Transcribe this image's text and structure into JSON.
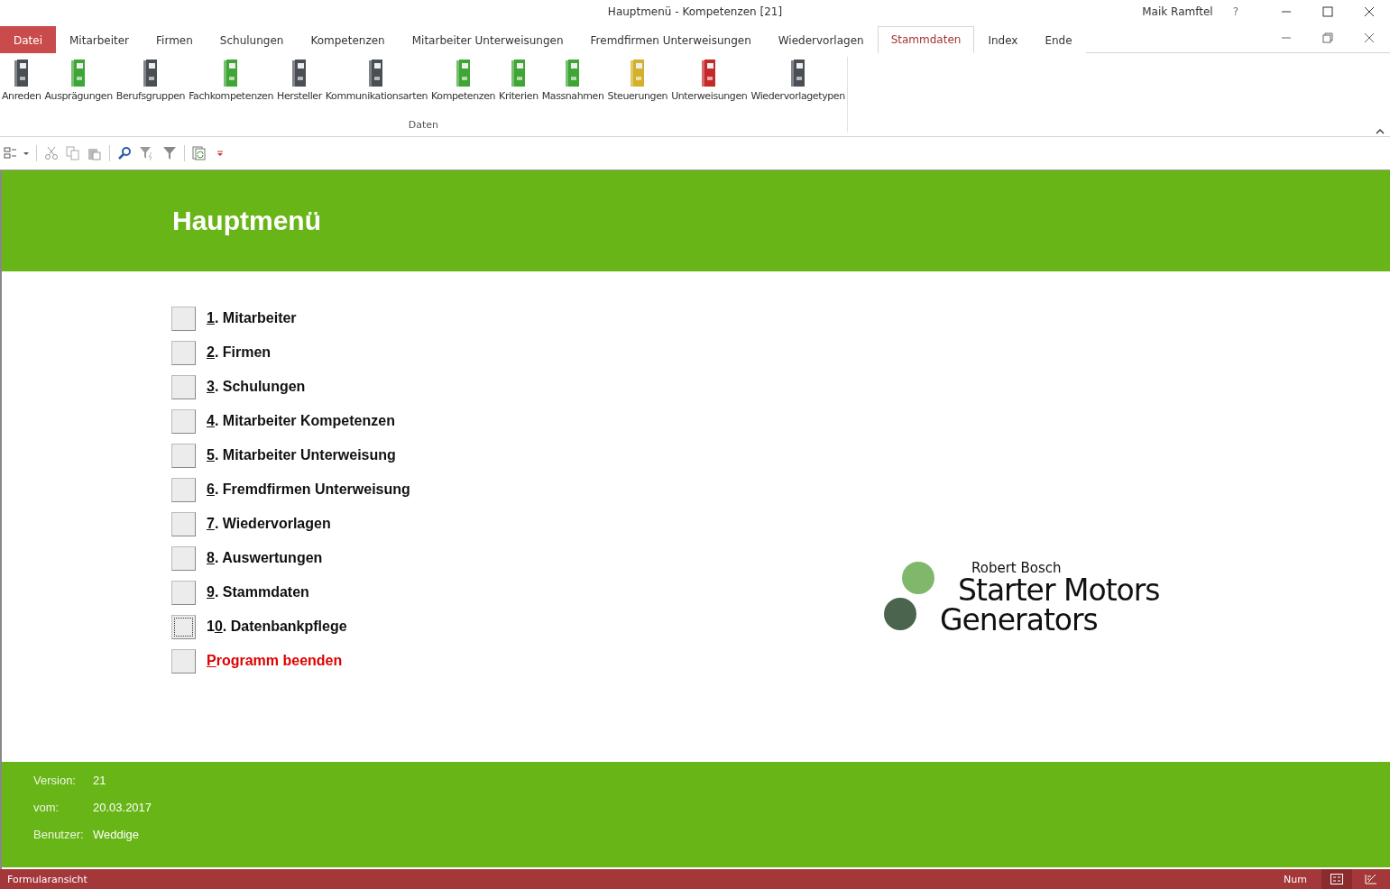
{
  "window": {
    "title": "Hauptmenü  -  Kompetenzen [21]",
    "user": "Maik Ramftel",
    "help": "?"
  },
  "tabs": [
    {
      "label": "Datei",
      "kind": "file",
      "selected": false
    },
    {
      "label": "Mitarbeiter",
      "kind": "tab",
      "selected": false
    },
    {
      "label": "Firmen",
      "kind": "tab",
      "selected": false
    },
    {
      "label": "Schulungen",
      "kind": "tab",
      "selected": false
    },
    {
      "label": "Kompetenzen",
      "kind": "tab",
      "selected": false
    },
    {
      "label": "Mitarbeiter Unterweisungen",
      "kind": "tab",
      "selected": false
    },
    {
      "label": "Fremdfirmen Unterweisungen",
      "kind": "tab",
      "selected": false
    },
    {
      "label": "Wiedervorlagen",
      "kind": "tab",
      "selected": false
    },
    {
      "label": "Stammdaten",
      "kind": "tab",
      "selected": true
    },
    {
      "label": "Index",
      "kind": "tab",
      "selected": false
    },
    {
      "label": "Ende",
      "kind": "tab",
      "selected": false
    }
  ],
  "ribbon": {
    "group": "Daten",
    "buttons": [
      {
        "label": "Anreden",
        "color": "#4a4f55"
      },
      {
        "label": "Ausprägungen",
        "color": "#3fa535"
      },
      {
        "label": "Berufsgruppen",
        "color": "#4a4f55"
      },
      {
        "label": "Fachkompetenzen",
        "color": "#3fa535"
      },
      {
        "label": "Hersteller",
        "color": "#4a4f55"
      },
      {
        "label": "Kommunikationsarten",
        "color": "#4a4f55"
      },
      {
        "label": "Kompetenzen",
        "color": "#3fa535"
      },
      {
        "label": "Kriterien",
        "color": "#3fa535"
      },
      {
        "label": "Massnahmen",
        "color": "#3fa535"
      },
      {
        "label": "Steuerungen",
        "color": "#d4b12a"
      },
      {
        "label": "Unterweisungen",
        "color": "#c42a2a"
      },
      {
        "label": "Wiedervorlagetypen",
        "color": "#4a4f55"
      }
    ]
  },
  "form": {
    "title": "Hauptmenü",
    "menu": [
      {
        "key": "1",
        "after": ". Mitarbeiter",
        "kind": "item",
        "focused": false
      },
      {
        "key": "2",
        "after": ". Firmen",
        "kind": "item",
        "focused": false
      },
      {
        "key": "3",
        "after": ". Schulungen",
        "kind": "item",
        "focused": false
      },
      {
        "key": "4",
        "after": ". Mitarbeiter Kompetenzen",
        "kind": "item",
        "focused": false
      },
      {
        "key": "5",
        "after": ". Mitarbeiter Unterweisung",
        "kind": "item",
        "focused": false
      },
      {
        "key": "6",
        "after": ". Fremdfirmen Unterweisung",
        "kind": "item",
        "focused": false
      },
      {
        "key": "7",
        "after": ". Wiedervorlagen",
        "kind": "item",
        "focused": false
      },
      {
        "key": "8",
        "after": ". Auswertungen",
        "kind": "item",
        "focused": false
      },
      {
        "key": "9",
        "after": ". Stammdaten",
        "kind": "item",
        "focused": false
      },
      {
        "before": "1",
        "key": "0",
        "after": ". Datenbankpflege",
        "kind": "item",
        "focused": true
      },
      {
        "key": "P",
        "after": "rogramm beenden",
        "kind": "exit",
        "focused": false
      }
    ],
    "logo": {
      "top": "Robert Bosch",
      "line1": "Starter Motors",
      "line2": "Generators"
    },
    "info": [
      {
        "label": "Version:",
        "value": "21"
      },
      {
        "label": "vom:",
        "value": "20.03.2017"
      },
      {
        "label": "Benutzer:",
        "value": "Weddige"
      }
    ]
  },
  "status_bar": {
    "text": "Formularansicht",
    "num": "Num",
    "views": [
      {
        "selected": true
      },
      {
        "selected": false
      }
    ]
  }
}
